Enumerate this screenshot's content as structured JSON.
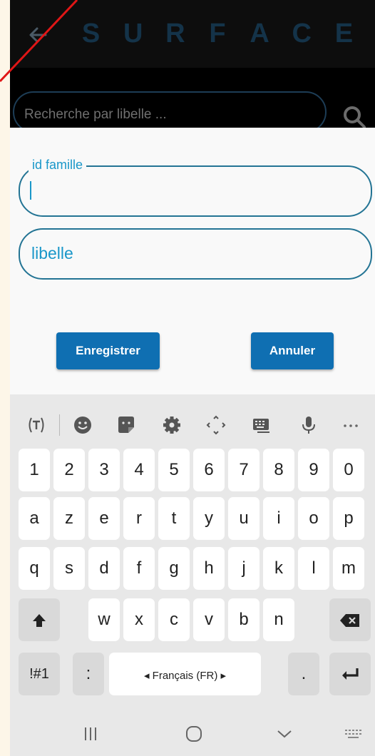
{
  "app": {
    "title_letters": [
      "S",
      "U",
      "R",
      "F",
      "A",
      "C",
      "E"
    ]
  },
  "search": {
    "placeholder": "Recherche par libelle ..."
  },
  "form": {
    "id_label": "id famille",
    "id_value": "",
    "libelle_placeholder": "libelle",
    "save_label": "Enregistrer",
    "cancel_label": "Annuler"
  },
  "keyboard": {
    "row_numbers": [
      "1",
      "2",
      "3",
      "4",
      "5",
      "6",
      "7",
      "8",
      "9",
      "0"
    ],
    "row_1": [
      "a",
      "z",
      "e",
      "r",
      "t",
      "y",
      "u",
      "i",
      "o",
      "p"
    ],
    "row_2": [
      "q",
      "s",
      "d",
      "f",
      "g",
      "h",
      "j",
      "k",
      "l",
      "m"
    ],
    "row_3": [
      "w",
      "x",
      "c",
      "v",
      "b",
      "n"
    ],
    "symbols_label": "!#1",
    "colon_label": ":",
    "period_label": ".",
    "language_label": "Français (FR)",
    "toolbar_icons": [
      "text-recognition-icon",
      "emoji-icon",
      "sticker-icon",
      "settings-icon",
      "cursor-move-icon",
      "keyboard-layout-icon",
      "microphone-icon",
      "more-icon"
    ]
  },
  "navbar": {
    "icons": [
      "recent-apps-icon",
      "home-icon",
      "hide-keyboard-icon",
      "keyboard-switch-icon"
    ]
  },
  "colors": {
    "appbar": "#0d0d0d",
    "title": "#143349",
    "accent": "#1a97c9",
    "button": "#0f6fb2",
    "keyboard": "#e8e8e8"
  }
}
